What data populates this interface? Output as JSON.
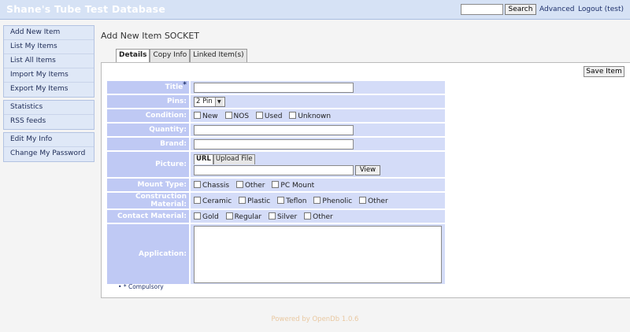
{
  "header": {
    "title": "Shane's Tube Test Database",
    "search_placeholder": "",
    "search_value": "",
    "search_button": "Search",
    "advanced_link": "Advanced",
    "logout_link": "Logout (test)"
  },
  "sidebar": {
    "groups": [
      [
        "Add New Item",
        "List My Items",
        "List All Items",
        "Import My Items",
        "Export My Items"
      ],
      [
        "Statistics",
        "RSS feeds"
      ],
      [
        "Edit My Info",
        "Change My Password"
      ]
    ]
  },
  "main": {
    "page_title": "Add New Item SOCKET",
    "tabs": [
      "Details",
      "Copy Info",
      "Linked Item(s)"
    ],
    "active_tab": "Details",
    "save_button": "Save Item"
  },
  "form": {
    "title_label": "Title",
    "title_value": "",
    "pins_label": "Pins:",
    "pins_selected": "2 Pin",
    "condition_label": "Condition:",
    "condition_options": [
      "New",
      "NOS",
      "Used",
      "Unknown"
    ],
    "quantity_label": "Quantity:",
    "quantity_value": "",
    "brand_label": "Brand:",
    "brand_value": "",
    "picture_label": "Picture:",
    "picture_tabs": [
      "URL",
      "Upload File"
    ],
    "picture_active_tab": "URL",
    "picture_url_value": "",
    "view_button": "View",
    "mount_type_label": "Mount Type:",
    "mount_type_options": [
      "Chassis",
      "Other",
      "PC Mount"
    ],
    "construction_label": "Construction Material:",
    "construction_options": [
      "Ceramic",
      "Plastic",
      "Teflon",
      "Phenolic",
      "Other"
    ],
    "contact_label": "Contact Material:",
    "contact_options": [
      "Gold",
      "Regular",
      "Silver",
      "Other"
    ],
    "application_label": "Application:",
    "application_value": ""
  },
  "footnote": "* Compulsory",
  "footer": "Powered by OpenDb 1.0.6",
  "colors": {
    "header_bg": "#d6e2f5",
    "label_bg": "#bfc9f4",
    "value_bg": "#d4dcf8",
    "link": "#1d2f6a",
    "footer_text": "#e9c8a1"
  }
}
